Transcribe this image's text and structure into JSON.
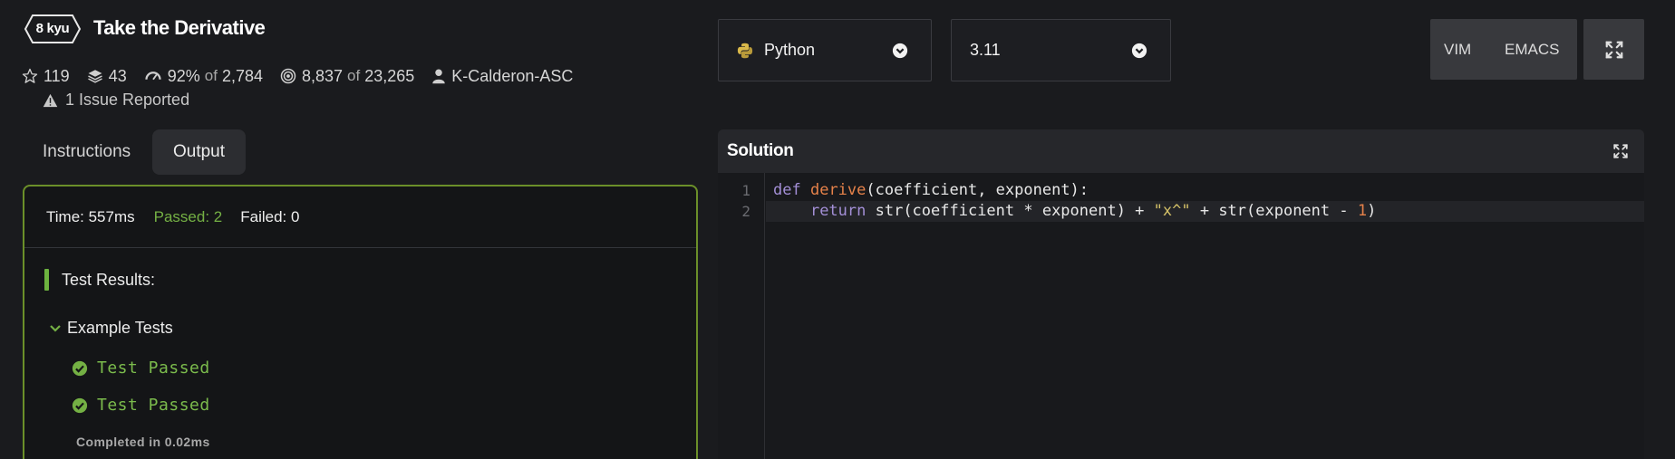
{
  "kata": {
    "rank": "8 kyu",
    "title": "Take the Derivative",
    "stats": {
      "stars": "119",
      "collections": "43",
      "satisfaction": "92%",
      "satisfaction_of": "of",
      "satisfaction_total": "2,784",
      "completed": "8,837",
      "completed_of": "of",
      "completed_total": "23,265",
      "author": "K-Calderon-ASC"
    },
    "issue": "1 Issue Reported"
  },
  "tabs": {
    "instructions": "Instructions",
    "output": "Output",
    "active": "output"
  },
  "output": {
    "time": "Time: 557ms",
    "passed": "Passed: 2",
    "failed": "Failed: 0",
    "results_title": "Test Results:",
    "group": "Example Tests",
    "tests": [
      "Test Passed",
      "Test Passed"
    ],
    "completed": "Completed in 0.02ms"
  },
  "selects": {
    "language": "Python",
    "version": "3.11"
  },
  "modes": {
    "vim": "VIM",
    "emacs": "EMACS"
  },
  "solution": {
    "title": "Solution",
    "line_numbers": [
      "1",
      "2"
    ],
    "line1": {
      "kw": "def",
      "fn": "derive",
      "rest": "(coefficient, exponent):"
    },
    "line2": {
      "indent": "    ",
      "kw": "return",
      "a": " str(coefficient * exponent) + ",
      "str": "\"x^\"",
      "b": " + str(exponent - ",
      "num": "1",
      "c": ")"
    }
  },
  "colors": {
    "background": "#1a1b1e",
    "panel_border": "#6b8f29",
    "passed": "#74b044",
    "keyword": "#a38fd6",
    "function": "#e6824a",
    "string": "#d4c168"
  }
}
